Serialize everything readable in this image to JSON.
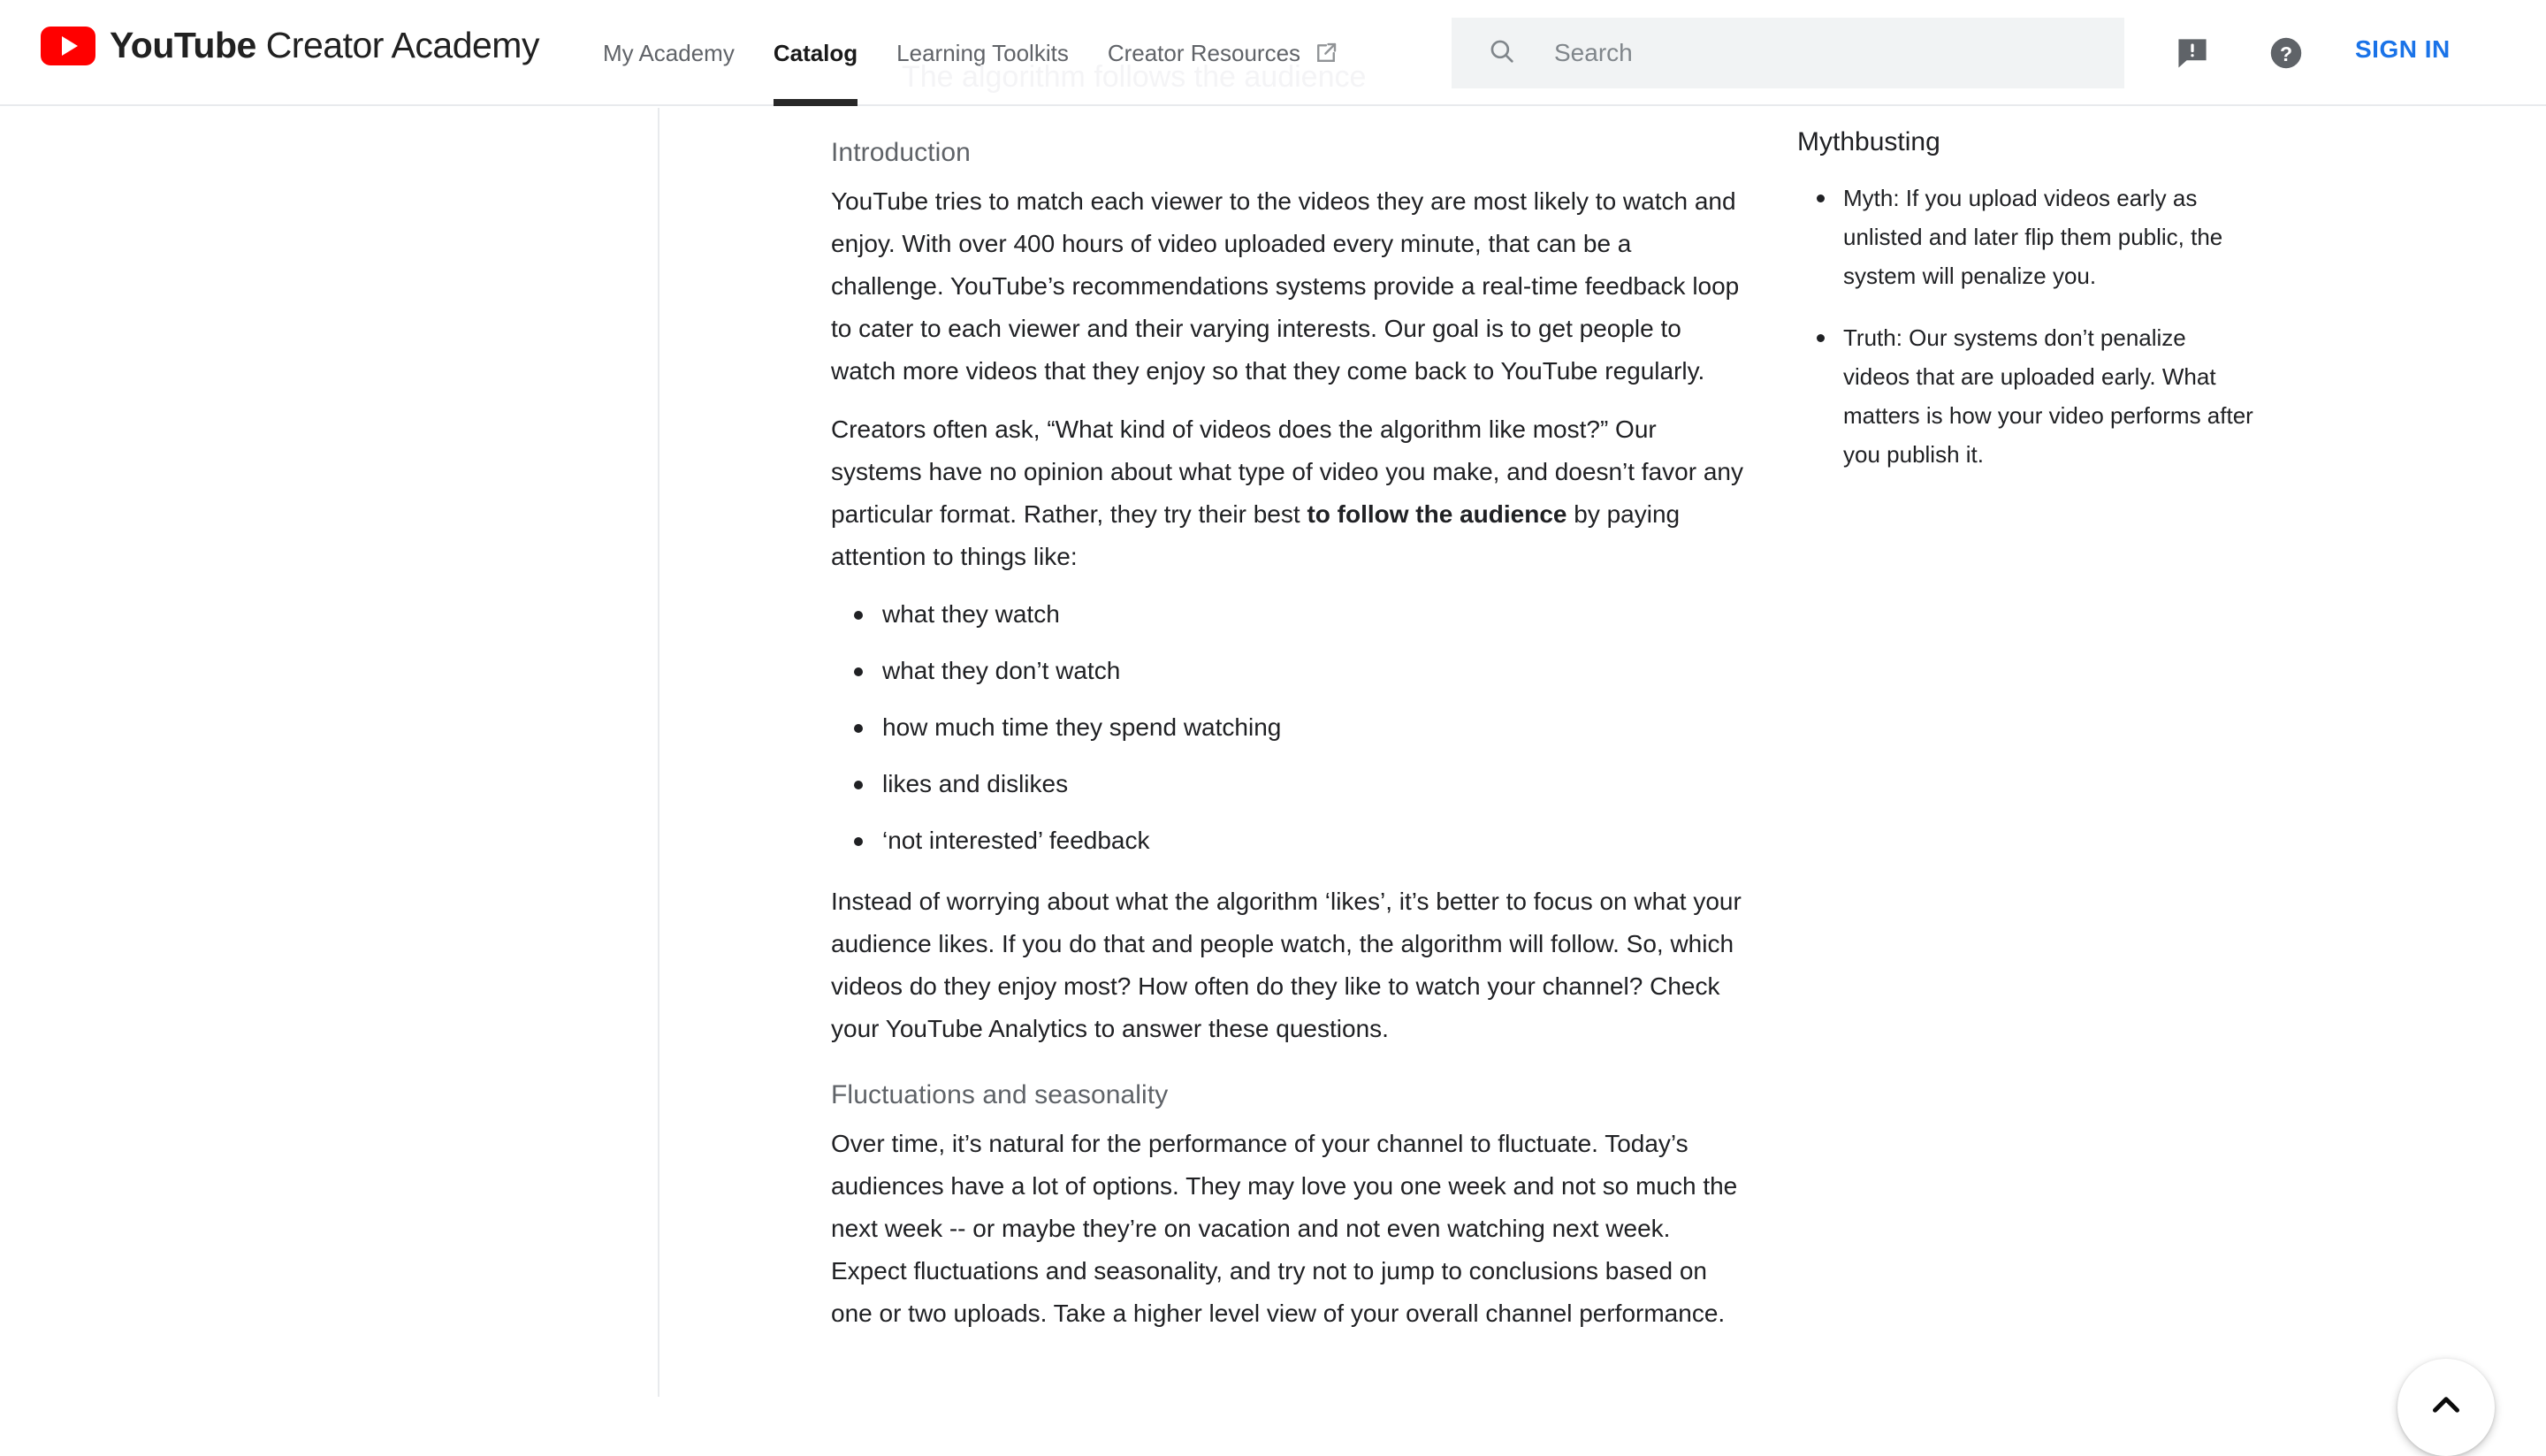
{
  "header": {
    "brand": {
      "bold": "YouTube",
      "regular": "Creator Academy",
      "logo_icon": "youtube-play-icon"
    },
    "nav": [
      {
        "label": "My Academy",
        "active": false,
        "external": false
      },
      {
        "label": "Catalog",
        "active": true,
        "external": false
      },
      {
        "label": "Learning Toolkits",
        "active": false,
        "external": false
      },
      {
        "label": "Creator Resources",
        "active": false,
        "external": true
      }
    ],
    "ghost_page_title": "The algorithm follows the audience",
    "search": {
      "placeholder": "Search",
      "icon": "search-icon",
      "value": ""
    },
    "feedback_icon": "feedback-icon",
    "help_icon": "help-icon",
    "sign_in_label": "SIGN IN",
    "accent_color": "#1a73e8",
    "brand_color": "#ff0000"
  },
  "article": {
    "section1_heading": "Introduction",
    "p1": "YouTube tries to match each viewer to the videos they are most likely to watch and enjoy. With over 400 hours of video uploaded every minute, that can be a challenge. YouTube’s recommendations systems provide a real-time feedback loop to cater to each viewer and their varying interests. Our goal is to get people to watch more videos that they enjoy so that they come back to YouTube regularly.",
    "p2_before": "Creators often ask, “What kind of videos does the algorithm like most?” Our systems have no opinion about what type of video you make, and doesn’t favor any particular format. Rather, they try their best ",
    "p2_bold": "to follow the audience",
    "p2_after": " by paying attention to things like:",
    "bullets": [
      "what they watch",
      "what they don’t watch",
      "how much time they spend watching",
      "likes and dislikes",
      "‘not interested’ feedback"
    ],
    "p3": "Instead of worrying about what the algorithm ‘likes’, it’s better to focus on what your audience likes. If you do that and people watch, the algorithm will follow. So, which videos do they enjoy most? How often do they like to watch your channel? Check your YouTube Analytics to answer these questions.",
    "section2_heading": "Fluctuations and seasonality",
    "p4": "Over time, it’s natural for the performance of your channel to fluctuate. Today’s audiences have a lot of options. They may love you one week and not so much the next week -- or maybe they’re on vacation and not even watching next week. Expect fluctuations and seasonality, and try not to jump to conclusions based on one or two uploads. Take a higher level view of your overall channel performance."
  },
  "sidebar": {
    "title": "Mythbusting",
    "items": [
      "Myth: If you upload videos early as unlisted and later flip them public, the system will penalize you.",
      "Truth: Our systems don’t penalize videos that are uploaded early. What matters is how your video performs after you publish it."
    ]
  },
  "fab": {
    "icon": "chevron-up-icon",
    "label": "Back to top"
  }
}
